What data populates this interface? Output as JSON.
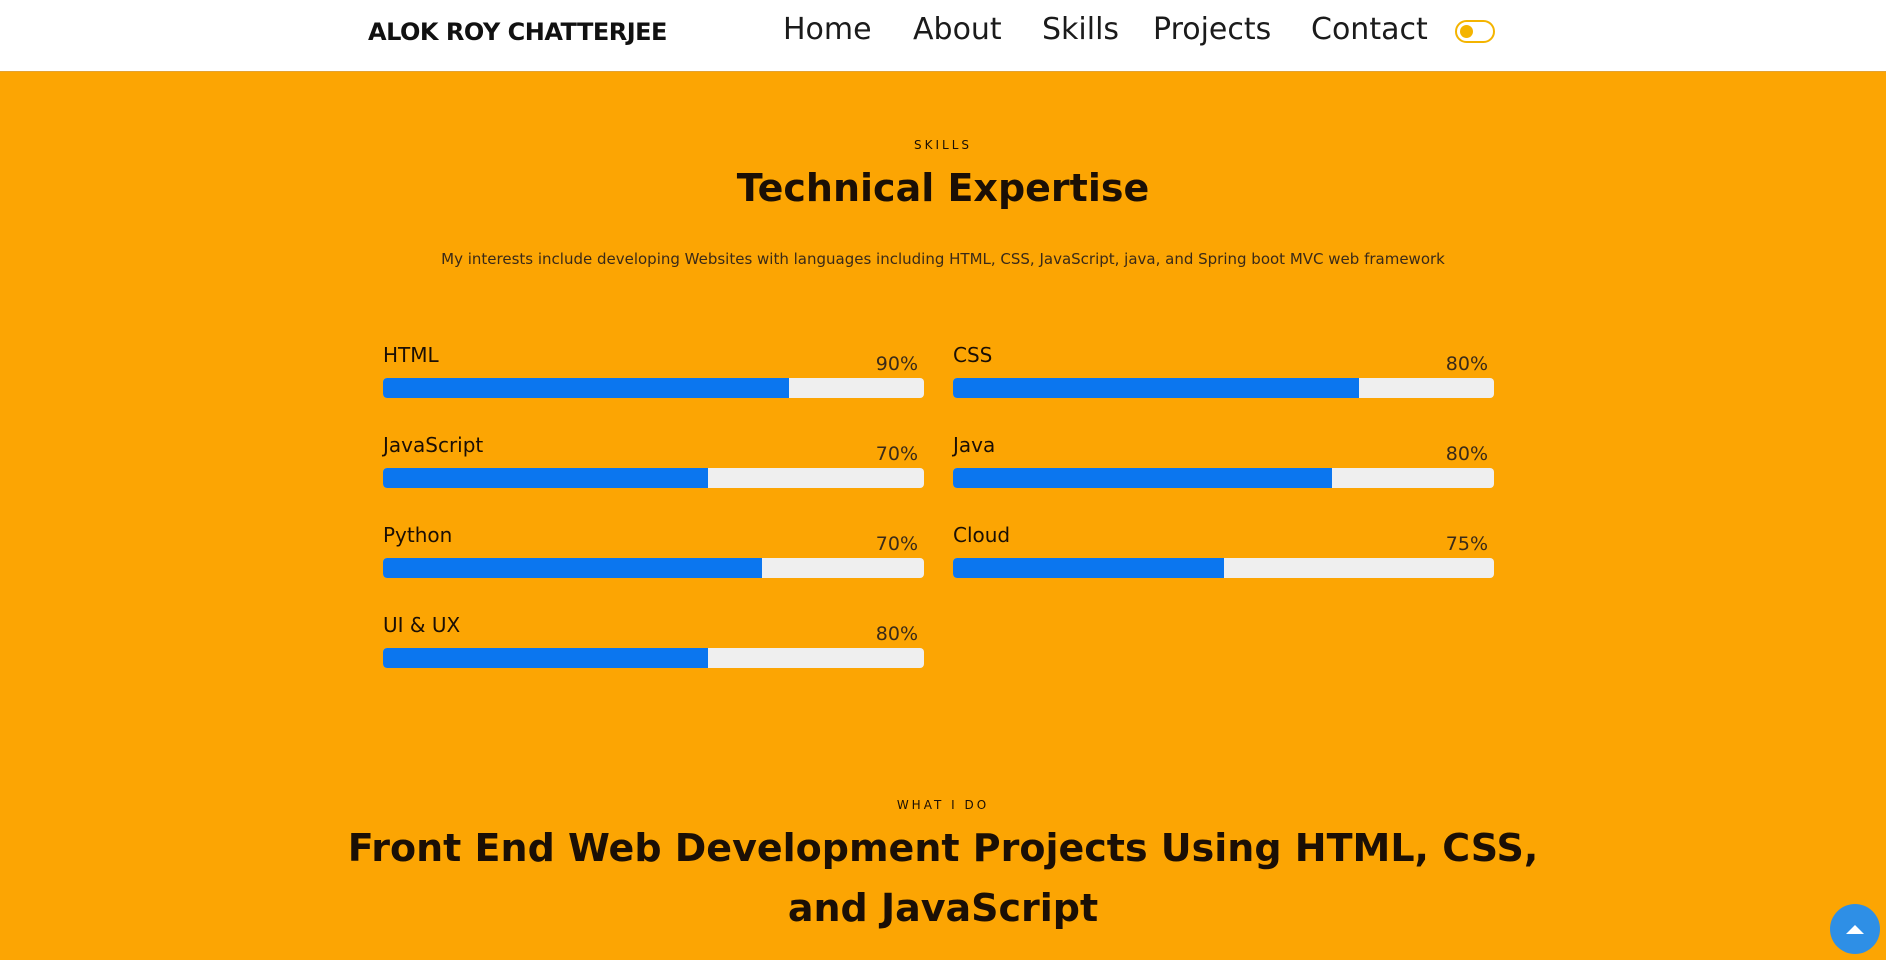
{
  "header": {
    "brand": "ALOK ROY CHATTERJEE",
    "nav": [
      "Home",
      "About",
      "Skills",
      "Projects",
      "Contact"
    ],
    "theme_toggle_icon": "toggle-switch-icon"
  },
  "skills_section": {
    "eyebrow": "SKILLS",
    "title": "Technical Expertise",
    "description": "My interests include developing Websites with languages including HTML, CSS, JavaScript, java, and Spring boot MVC web framework",
    "items": [
      {
        "name": "HTML",
        "percent_label": "90%",
        "fill_fraction": 0.75
      },
      {
        "name": "CSS",
        "percent_label": "80%",
        "fill_fraction": 0.75
      },
      {
        "name": "JavaScript",
        "percent_label": "70%",
        "fill_fraction": 0.6
      },
      {
        "name": "Java",
        "percent_label": "80%",
        "fill_fraction": 0.7
      },
      {
        "name": "Python",
        "percent_label": "70%",
        "fill_fraction": 0.7
      },
      {
        "name": "Cloud",
        "percent_label": "75%",
        "fill_fraction": 0.5
      },
      {
        "name": "UI & UX",
        "percent_label": "80%",
        "fill_fraction": 0.6
      }
    ]
  },
  "what_i_do": {
    "eyebrow": "WHAT I DO",
    "title_line1": "Front End Web Development Projects Using HTML, CSS,",
    "title_line2": "and JavaScript"
  },
  "scroll_top": {
    "icon": "arrow-up-icon"
  },
  "colors": {
    "page_background": "#fca503",
    "bar_fill": "#0b76ef",
    "bar_track": "#efefef",
    "toggle_accent": "#f4b400",
    "scroll_button": "#2e8fe6"
  }
}
